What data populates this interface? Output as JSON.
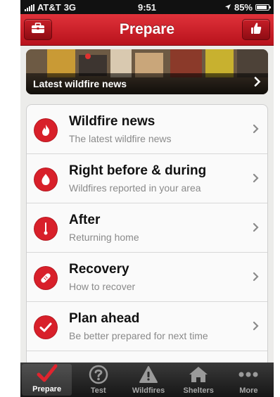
{
  "status_bar": {
    "carrier": "AT&T",
    "network": "3G",
    "time": "9:51",
    "battery": "85%",
    "battery_level": 0.85
  },
  "nav_bar": {
    "title": "Prepare",
    "left_icon": "briefcase-icon",
    "right_icon": "thumbs-up-icon",
    "color": "#c8161f"
  },
  "banner": {
    "caption": "Latest wildfire news"
  },
  "list": {
    "items": [
      {
        "title": "Wildfire news",
        "subtitle": "The latest wildfire news",
        "icon": "flame-icon"
      },
      {
        "title": "Right before & during",
        "subtitle": "Wildfires reported in your area",
        "icon": "flame-icon"
      },
      {
        "title": "After",
        "subtitle": "Returning home",
        "icon": "thermometer-icon"
      },
      {
        "title": "Recovery",
        "subtitle": "How to recover",
        "icon": "bandage-icon"
      },
      {
        "title": "Plan ahead",
        "subtitle": "Be better prepared for next time",
        "icon": "checkmark-icon"
      }
    ]
  },
  "tab_bar": {
    "tabs": [
      {
        "label": "Prepare",
        "icon": "checkmark-icon",
        "active": true
      },
      {
        "label": "Test",
        "icon": "question-icon",
        "active": false
      },
      {
        "label": "Wildfires",
        "icon": "warning-icon",
        "active": false
      },
      {
        "label": "Shelters",
        "icon": "house-icon",
        "active": false
      },
      {
        "label": "More",
        "icon": "more-dots-icon",
        "active": false
      }
    ]
  },
  "colors": {
    "accent": "#d8202a",
    "tab_bar": "#222222"
  }
}
